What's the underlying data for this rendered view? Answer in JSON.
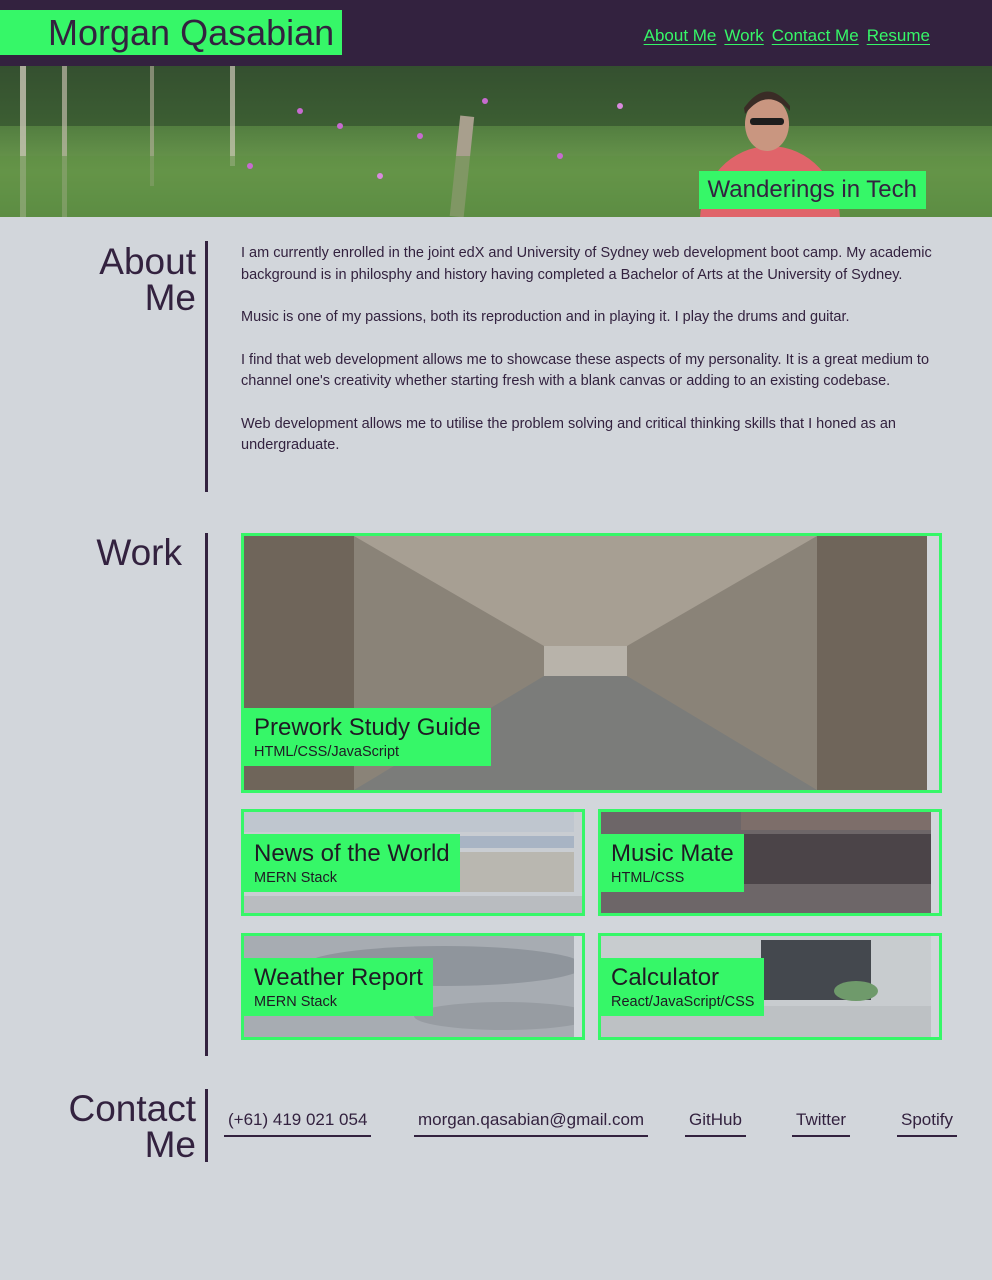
{
  "header": {
    "brand": "Morgan Qasabian",
    "nav": [
      "About Me",
      "Work",
      "Contact Me",
      "Resume"
    ],
    "colors": {
      "bar": "#33223f",
      "accent": "#36f768"
    }
  },
  "hero": {
    "tagline": "Wanderings in Tech"
  },
  "about": {
    "title_line1": "About",
    "title_line2": "Me",
    "paragraphs": [
      "I am currently enrolled in the joint edX and University of Sydney web development boot camp. My academic background is in philosphy and history having completed a Bachelor of Arts at the University of Sydney.",
      "Music is one of my passions, both its reproduction and in playing it. I play the drums and guitar.",
      "I find that web development allows me to showcase these aspects of my personality. It is a great medium to channel one's creativity whether starting fresh with a blank canvas or adding to an existing codebase.",
      "Web development allows me to utilise the problem solving and critical thinking skills that I honed as an undergraduate."
    ]
  },
  "work": {
    "title": "Work",
    "projects": [
      {
        "title": "Prework Study Guide",
        "stack": "HTML/CSS/JavaScript"
      },
      {
        "title": "News of the World",
        "stack": "MERN Stack"
      },
      {
        "title": "Music Mate",
        "stack": "HTML/CSS"
      },
      {
        "title": "Weather Report",
        "stack": "MERN Stack"
      },
      {
        "title": "Calculator",
        "stack": "React/JavaScript/CSS"
      }
    ]
  },
  "contact": {
    "title_line1": "Contact",
    "title_line2": "Me",
    "links": [
      "(+61) 419 021 054",
      "morgan.qasabian@gmail.com",
      "GitHub",
      "Twitter",
      "Spotify"
    ]
  }
}
